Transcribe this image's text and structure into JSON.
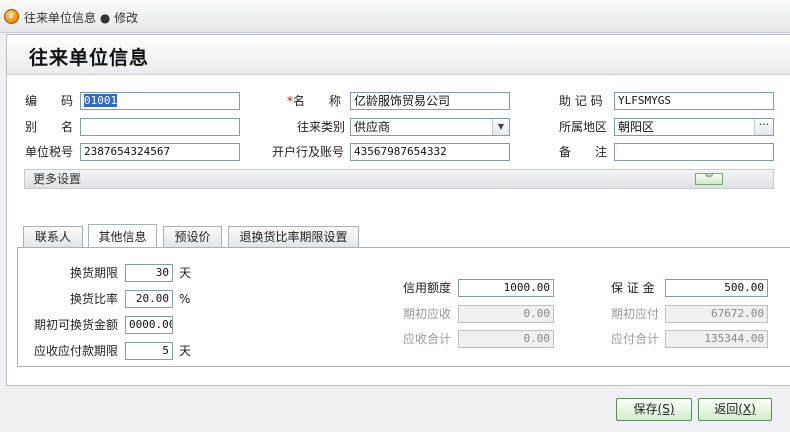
{
  "window": {
    "title": "往来单位信息 ● 修改"
  },
  "page": {
    "title": "往来单位信息"
  },
  "form": {
    "code": {
      "label": "编　　码",
      "value": "01001"
    },
    "name": {
      "required_mark": "*",
      "label": "名　　称",
      "value": "亿龄服饰贸易公司"
    },
    "mnemonic": {
      "label": "助 记 码",
      "value": "YLFSMYGS"
    },
    "alias": {
      "label": "别　　名",
      "value": ""
    },
    "category": {
      "label": "往来类别",
      "value": "供应商"
    },
    "region": {
      "label": "所属地区",
      "value": "朝阳区"
    },
    "tax_no": {
      "label": "单位税号",
      "value": "2387654324567"
    },
    "bank_account": {
      "label": "开户行及账号",
      "value": "43567987654332"
    },
    "remark": {
      "label": "备　　注",
      "value": ""
    }
  },
  "more_settings": {
    "label": "更多设置"
  },
  "tabs": [
    {
      "label": "联系人",
      "active": false
    },
    {
      "label": "其他信息",
      "active": true
    },
    {
      "label": "预设价",
      "active": false
    },
    {
      "label": "退换货比率期限设置",
      "active": false
    }
  ],
  "other_info": {
    "exchange_period": {
      "label": "换货期限",
      "value": "30",
      "unit": "天"
    },
    "exchange_ratio": {
      "label": "换货比率",
      "value": "20.00",
      "unit": "%"
    },
    "initial_exchange_amount": {
      "label": "期初可换货金额",
      "value": "0000.00"
    },
    "ar_ap_period": {
      "label": "应收应付款期限",
      "value": "5",
      "unit": "天"
    },
    "credit_limit": {
      "label": "信用额度",
      "value": "1000.00"
    },
    "initial_receivable": {
      "label": "期初应收",
      "value": "0.00"
    },
    "total_receivable": {
      "label": "应收合计",
      "value": "0.00"
    },
    "deposit": {
      "label": "保 证 金",
      "value": "500.00"
    },
    "initial_payable": {
      "label": "期初应付",
      "value": "67672.00"
    },
    "total_payable": {
      "label": "应付合计",
      "value": "135344.00"
    }
  },
  "buttons": {
    "save": {
      "label": "保存",
      "mnemonic": "(S)"
    },
    "back": {
      "label": "返回",
      "mnemonic": "(X)"
    }
  },
  "icons": {
    "app": "app-logo-icon",
    "dropdown": "chevron-down-icon",
    "browse": "ellipsis-icon",
    "expand": "double-chevron-down-icon"
  }
}
